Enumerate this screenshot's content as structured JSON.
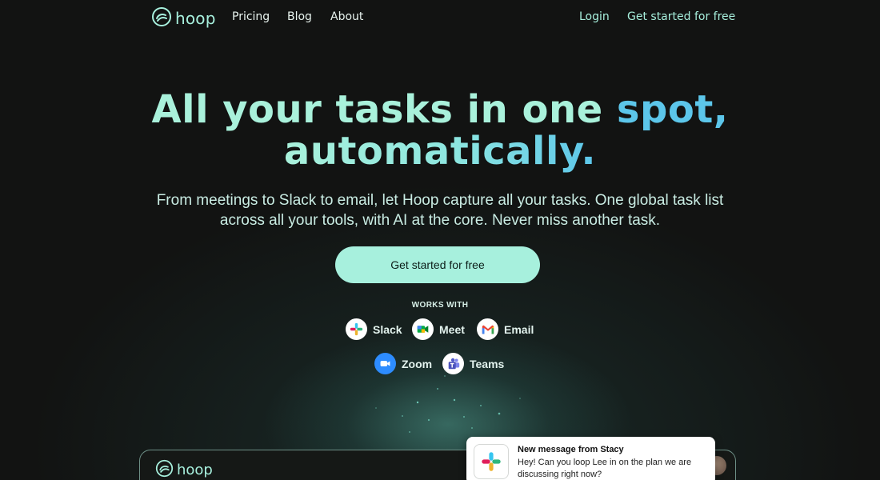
{
  "nav": {
    "brand": "hoop",
    "links": [
      "Pricing",
      "Blog",
      "About"
    ],
    "login": "Login",
    "cta": "Get started for free"
  },
  "hero": {
    "title_line1_a": "All your tasks in one",
    "title_line1_b": "spot,",
    "title_line2": "automatically.",
    "subtitle_line1": "From meetings to Slack to email, let Hoop capture all your tasks. One global task list",
    "subtitle_line2": "across all your tools, with AI at the core. Never miss another task.",
    "cta": "Get started for free"
  },
  "works_with": {
    "heading": "WORKS WITH",
    "integrations": [
      {
        "label": "Slack",
        "icon": "slack-icon"
      },
      {
        "label": "Meet",
        "icon": "google-meet-icon"
      },
      {
        "label": "Email",
        "icon": "gmail-icon"
      },
      {
        "label": "Zoom",
        "icon": "zoom-icon"
      },
      {
        "label": "Teams",
        "icon": "teams-icon"
      }
    ]
  },
  "preview": {
    "brand": "hoop",
    "notification": {
      "title": "New message from Stacy",
      "body": "Hey! Can you loop Lee in on the plan we are discussing right now?",
      "icon": "slack-icon"
    }
  },
  "colors": {
    "background": "#121312",
    "accent_mint": "#a7f0dd",
    "accent_blue": "#5cc6ea"
  }
}
